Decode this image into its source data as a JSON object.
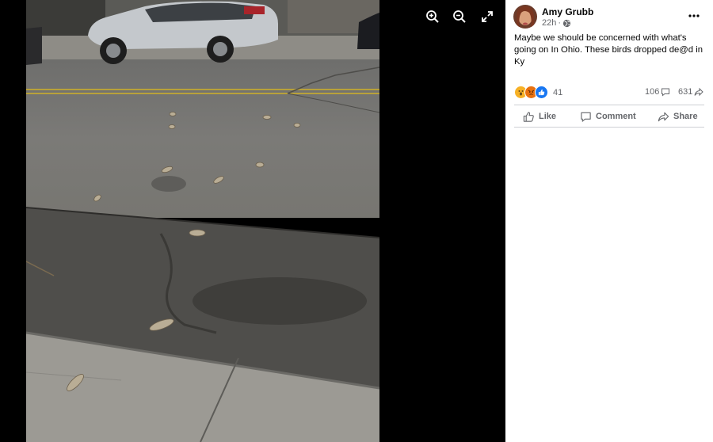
{
  "viewer": {
    "controls": [
      {
        "name": "zoom-in-button",
        "icon": "zoom-in-icon"
      },
      {
        "name": "zoom-out-button",
        "icon": "zoom-out-icon"
      },
      {
        "name": "fullscreen-button",
        "icon": "fullscreen-icon"
      }
    ]
  },
  "post": {
    "author": "Amy Grubb",
    "time": "22h",
    "audience_icon": "globe-icon",
    "text": "Maybe we should be concerned with what's going on In Ohio. These birds dropped de@d in Ky",
    "reactions": {
      "icons": [
        "wow-emoji-icon",
        "angry-emoji-icon",
        "like-reaction-icon"
      ],
      "count": "41"
    },
    "comments": "106",
    "shares": "631",
    "actions": {
      "like": "Like",
      "comment": "Comment",
      "share": "Share"
    }
  },
  "colors": {
    "text_primary": "#050505",
    "text_secondary": "#65676b",
    "like_blue": "#1877f2",
    "divider": "#ced0d4"
  }
}
